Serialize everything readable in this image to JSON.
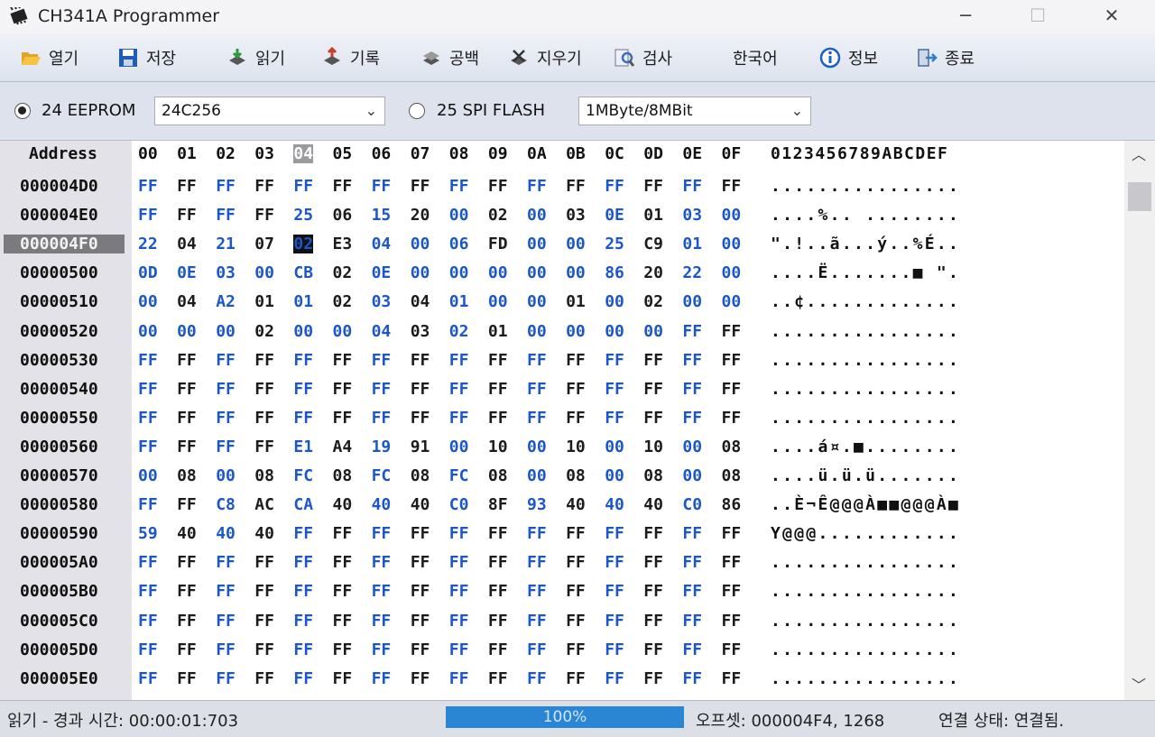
{
  "window": {
    "title": "CH341A Programmer"
  },
  "toolbar": {
    "items": [
      {
        "label": "열기",
        "icon": "folder-open-icon"
      },
      {
        "label": "저장",
        "icon": "floppy-save-icon"
      },
      {
        "label": "읽기",
        "icon": "chip-read-icon"
      },
      {
        "label": "기록",
        "icon": "chip-write-icon"
      },
      {
        "label": "공백",
        "icon": "chip-blank-icon"
      },
      {
        "label": "지우기",
        "icon": "chip-erase-icon"
      },
      {
        "label": "검사",
        "icon": "magnifier-verify-icon"
      },
      {
        "label": "한국어",
        "icon": ""
      },
      {
        "label": "정보",
        "icon": "info-icon"
      },
      {
        "label": "종료",
        "icon": "exit-icon"
      }
    ]
  },
  "chip": {
    "eeprom_label": "24 EEPROM",
    "eeprom_selected": true,
    "eeprom_model": "24C256",
    "spi_label": "25 SPI FLASH",
    "spi_selected": false,
    "spi_size": "1MByte/8MBit"
  },
  "editor": {
    "address_header": "Address",
    "column_headers": [
      "00",
      "01",
      "02",
      "03",
      "04",
      "05",
      "06",
      "07",
      "08",
      "09",
      "0A",
      "0B",
      "0C",
      "0D",
      "0E",
      "0F"
    ],
    "ascii_header": "0123456789ABCDEF",
    "selected_column": 4,
    "selected_row": 2,
    "rows": [
      {
        "address": "000004D0",
        "bytes": [
          "FF",
          "FF",
          "FF",
          "FF",
          "FF",
          "FF",
          "FF",
          "FF",
          "FF",
          "FF",
          "FF",
          "FF",
          "FF",
          "FF",
          "FF",
          "FF"
        ],
        "ascii": "................"
      },
      {
        "address": "000004E0",
        "bytes": [
          "FF",
          "FF",
          "FF",
          "FF",
          "25",
          "06",
          "15",
          "20",
          "00",
          "02",
          "00",
          "03",
          "0E",
          "01",
          "03",
          "00"
        ],
        "ascii": "....%.. ........"
      },
      {
        "address": "000004F0",
        "bytes": [
          "22",
          "04",
          "21",
          "07",
          "02",
          "E3",
          "04",
          "00",
          "06",
          "FD",
          "00",
          "00",
          "25",
          "C9",
          "01",
          "00"
        ],
        "ascii": "\".!..ã...ý..%É.."
      },
      {
        "address": "00000500",
        "bytes": [
          "0D",
          "0E",
          "03",
          "00",
          "CB",
          "02",
          "0E",
          "00",
          "00",
          "00",
          "00",
          "00",
          "86",
          "20",
          "22",
          "00"
        ],
        "ascii": "....Ë.......■ \"."
      },
      {
        "address": "00000510",
        "bytes": [
          "00",
          "04",
          "A2",
          "01",
          "01",
          "02",
          "03",
          "04",
          "01",
          "00",
          "00",
          "01",
          "00",
          "02",
          "00",
          "00"
        ],
        "ascii": "..¢............."
      },
      {
        "address": "00000520",
        "bytes": [
          "00",
          "00",
          "00",
          "02",
          "00",
          "00",
          "04",
          "03",
          "02",
          "01",
          "00",
          "00",
          "00",
          "00",
          "FF",
          "FF"
        ],
        "ascii": "................"
      },
      {
        "address": "00000530",
        "bytes": [
          "FF",
          "FF",
          "FF",
          "FF",
          "FF",
          "FF",
          "FF",
          "FF",
          "FF",
          "FF",
          "FF",
          "FF",
          "FF",
          "FF",
          "FF",
          "FF"
        ],
        "ascii": "................"
      },
      {
        "address": "00000540",
        "bytes": [
          "FF",
          "FF",
          "FF",
          "FF",
          "FF",
          "FF",
          "FF",
          "FF",
          "FF",
          "FF",
          "FF",
          "FF",
          "FF",
          "FF",
          "FF",
          "FF"
        ],
        "ascii": "................"
      },
      {
        "address": "00000550",
        "bytes": [
          "FF",
          "FF",
          "FF",
          "FF",
          "FF",
          "FF",
          "FF",
          "FF",
          "FF",
          "FF",
          "FF",
          "FF",
          "FF",
          "FF",
          "FF",
          "FF"
        ],
        "ascii": "................"
      },
      {
        "address": "00000560",
        "bytes": [
          "FF",
          "FF",
          "FF",
          "FF",
          "E1",
          "A4",
          "19",
          "91",
          "00",
          "10",
          "00",
          "10",
          "00",
          "10",
          "00",
          "08"
        ],
        "ascii": "....á¤.■........"
      },
      {
        "address": "00000570",
        "bytes": [
          "00",
          "08",
          "00",
          "08",
          "FC",
          "08",
          "FC",
          "08",
          "FC",
          "08",
          "00",
          "08",
          "00",
          "08",
          "00",
          "08"
        ],
        "ascii": "....ü.ü.ü......."
      },
      {
        "address": "00000580",
        "bytes": [
          "FF",
          "FF",
          "C8",
          "AC",
          "CA",
          "40",
          "40",
          "40",
          "C0",
          "8F",
          "93",
          "40",
          "40",
          "40",
          "C0",
          "86"
        ],
        "ascii": "..È¬Ê@@@À■■@@@À■"
      },
      {
        "address": "00000590",
        "bytes": [
          "59",
          "40",
          "40",
          "40",
          "FF",
          "FF",
          "FF",
          "FF",
          "FF",
          "FF",
          "FF",
          "FF",
          "FF",
          "FF",
          "FF",
          "FF"
        ],
        "ascii": "Y@@@............"
      },
      {
        "address": "000005A0",
        "bytes": [
          "FF",
          "FF",
          "FF",
          "FF",
          "FF",
          "FF",
          "FF",
          "FF",
          "FF",
          "FF",
          "FF",
          "FF",
          "FF",
          "FF",
          "FF",
          "FF"
        ],
        "ascii": "................"
      },
      {
        "address": "000005B0",
        "bytes": [
          "FF",
          "FF",
          "FF",
          "FF",
          "FF",
          "FF",
          "FF",
          "FF",
          "FF",
          "FF",
          "FF",
          "FF",
          "FF",
          "FF",
          "FF",
          "FF"
        ],
        "ascii": "................"
      },
      {
        "address": "000005C0",
        "bytes": [
          "FF",
          "FF",
          "FF",
          "FF",
          "FF",
          "FF",
          "FF",
          "FF",
          "FF",
          "FF",
          "FF",
          "FF",
          "FF",
          "FF",
          "FF",
          "FF"
        ],
        "ascii": "................"
      },
      {
        "address": "000005D0",
        "bytes": [
          "FF",
          "FF",
          "FF",
          "FF",
          "FF",
          "FF",
          "FF",
          "FF",
          "FF",
          "FF",
          "FF",
          "FF",
          "FF",
          "FF",
          "FF",
          "FF"
        ],
        "ascii": "................"
      },
      {
        "address": "000005E0",
        "bytes": [
          "FF",
          "FF",
          "FF",
          "FF",
          "FF",
          "FF",
          "FF",
          "FF",
          "FF",
          "FF",
          "FF",
          "FF",
          "FF",
          "FF",
          "FF",
          "FF"
        ],
        "ascii": "................"
      }
    ]
  },
  "status": {
    "elapsed": "읽기 - 경과 시간: 00:00:01:703",
    "progress_text": "100%",
    "progress_value": 1.0,
    "offset": "오프셋: 000004F4, 1268",
    "connection": "연결 상태: 연결됨."
  },
  "colors": {
    "hex_even": "#1c57c9",
    "hex_odd": "#1c1c1c",
    "progress": "#2a86d4",
    "address_bg": "#e2e2e8"
  }
}
